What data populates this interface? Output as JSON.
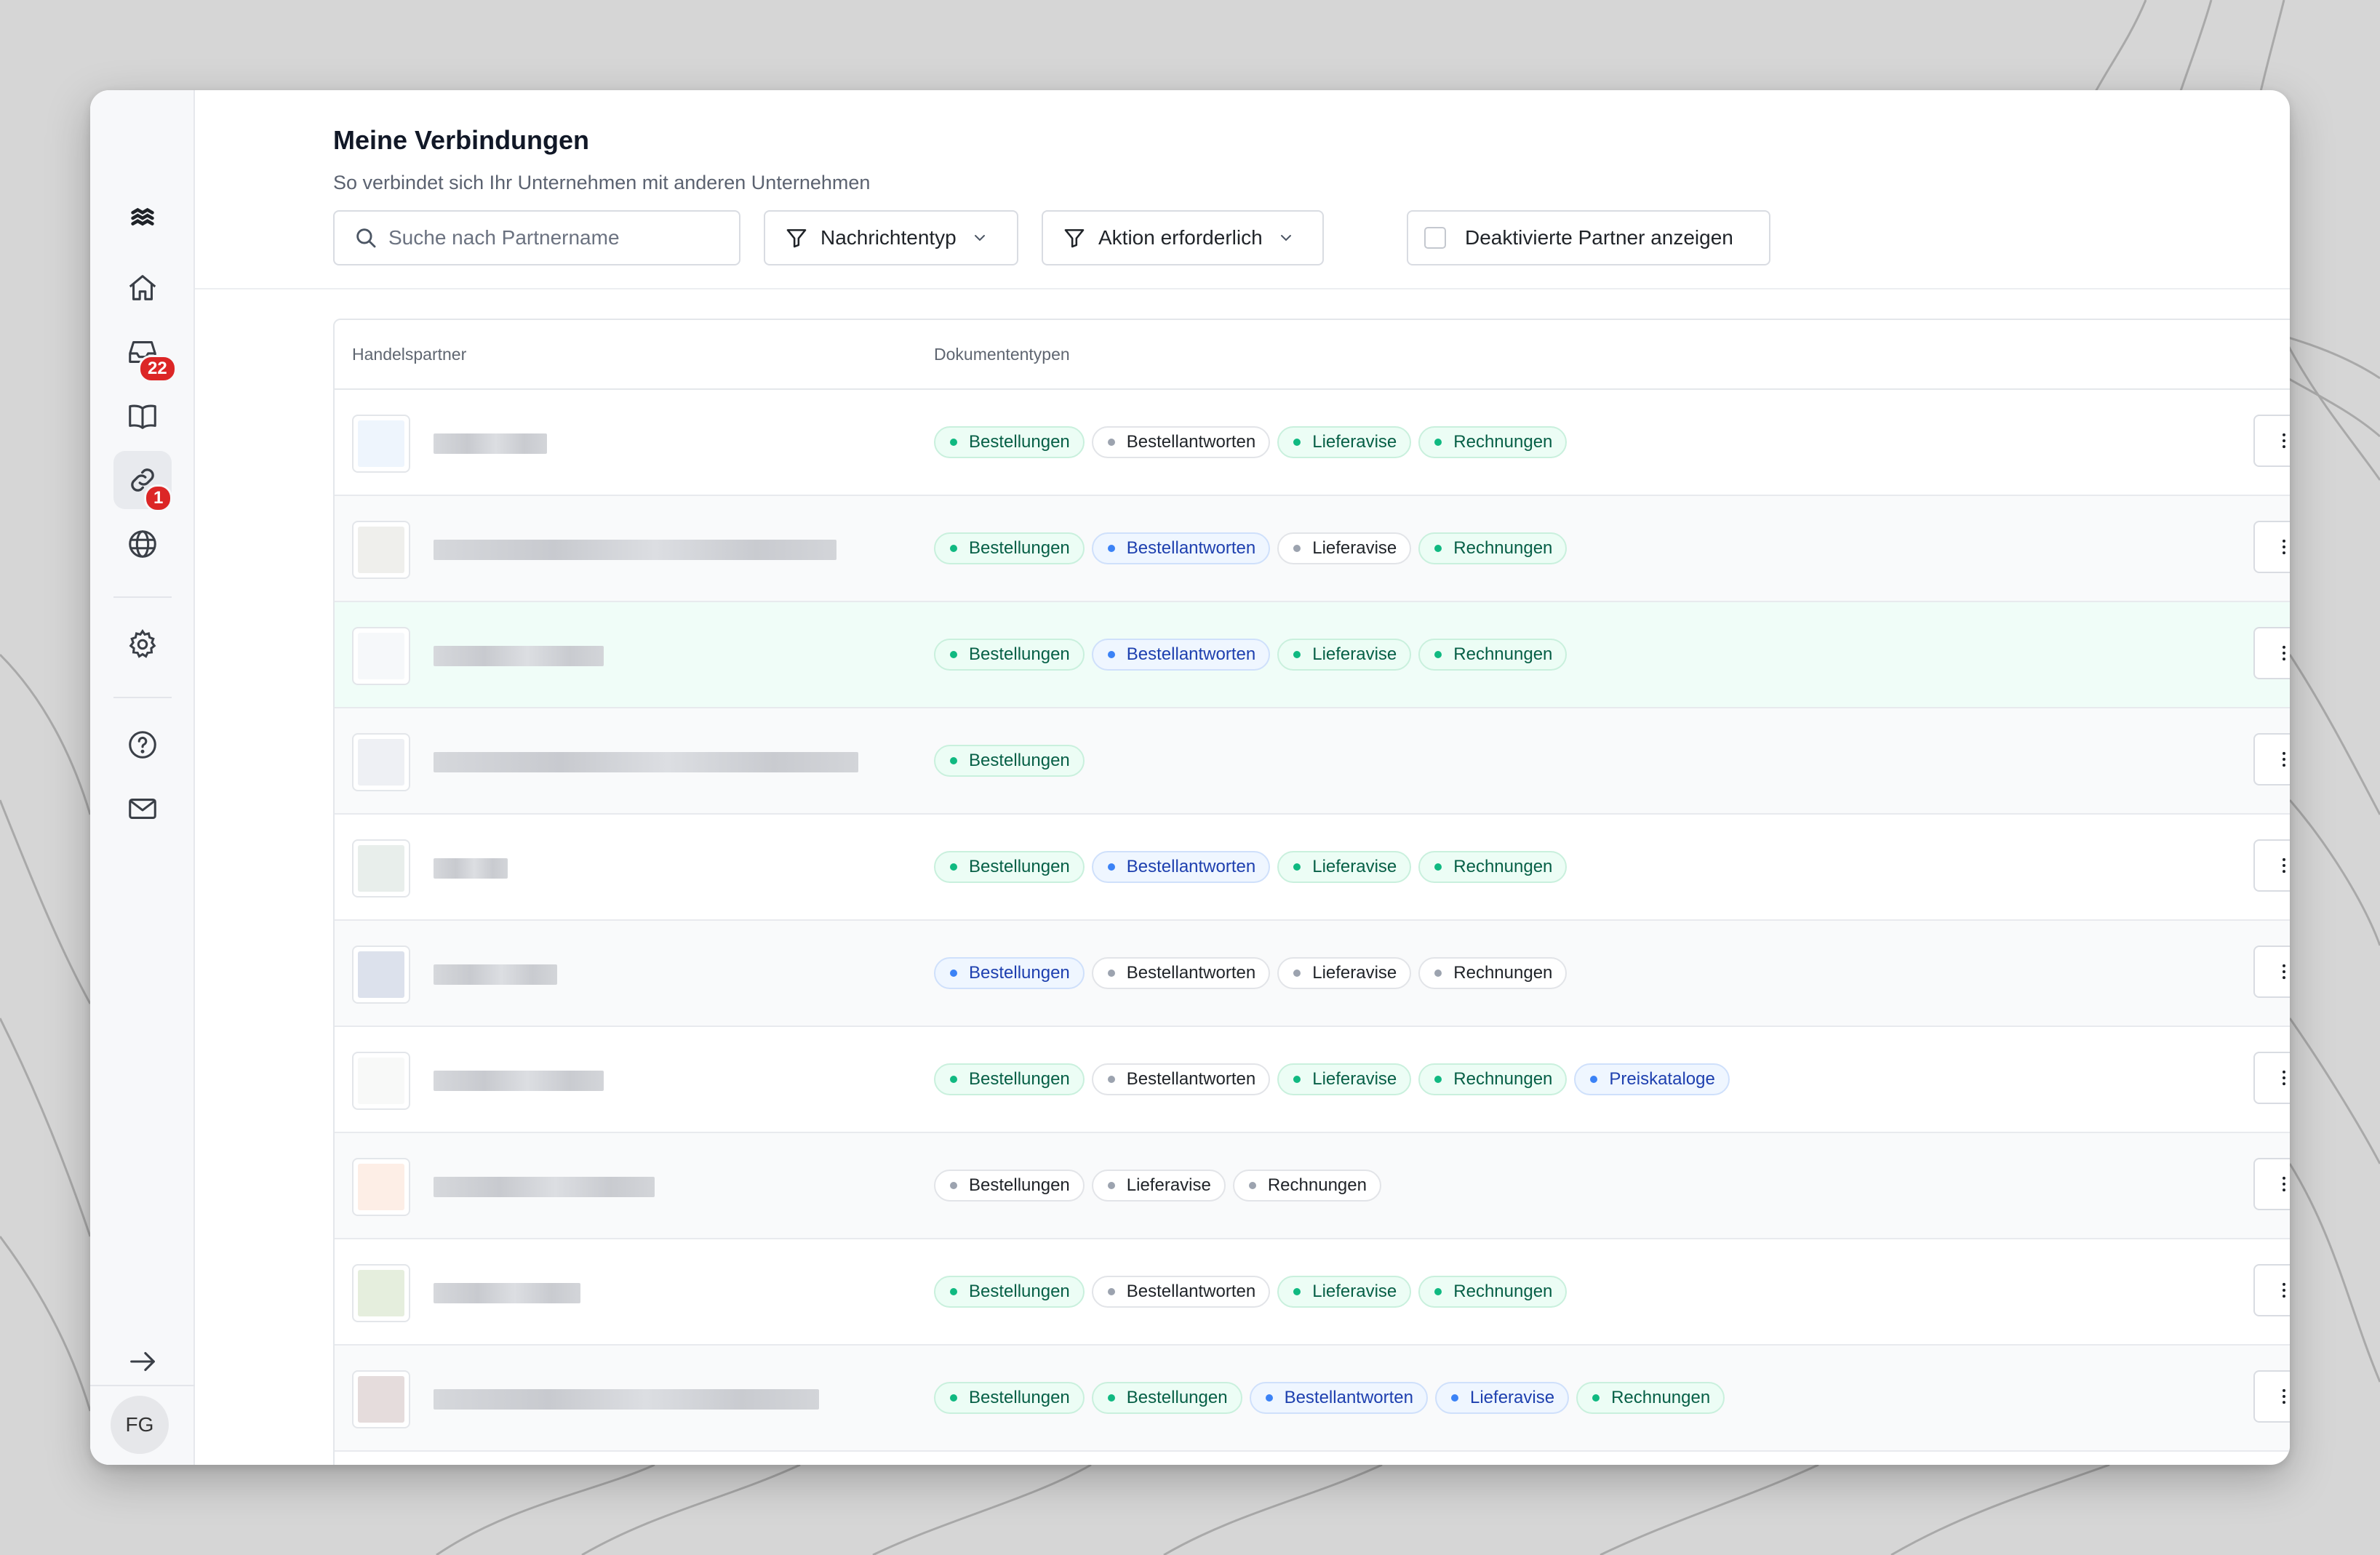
{
  "header": {
    "title": "Meine Verbindungen",
    "subtitle": "So verbindet sich Ihr Unternehmen mit anderen Unternehmen"
  },
  "search": {
    "placeholder": "Suche nach Partnername",
    "value": ""
  },
  "filters": {
    "message_type": "Nachrichtentyp",
    "action_required": "Aktion erforderlich",
    "show_deactivated": "Deaktivierte Partner anzeigen",
    "show_deactivated_checked": false
  },
  "sidebar": {
    "logo_icon": "wave-logo-icon",
    "items": [
      {
        "icon": "home-icon"
      },
      {
        "icon": "inbox-icon",
        "badge": "22"
      },
      {
        "icon": "book-icon"
      },
      {
        "icon": "link-icon",
        "badge": "1",
        "active": true
      },
      {
        "icon": "globe-icon"
      },
      {
        "icon": "gear-icon"
      },
      {
        "icon": "help-icon"
      },
      {
        "icon": "mail-icon"
      },
      {
        "icon": "arrow-right-icon"
      }
    ],
    "avatar": "FG"
  },
  "table": {
    "columns": [
      "Handelspartner",
      "Dokumententypen"
    ],
    "rows": [
      {
        "tags": [
          [
            "Bestellungen",
            "green"
          ],
          [
            "Bestellantworten",
            "gray"
          ],
          [
            "Lieferavise",
            "green"
          ],
          [
            "Rechnungen",
            "green"
          ]
        ]
      },
      {
        "tags": [
          [
            "Bestellungen",
            "green"
          ],
          [
            "Bestellantworten",
            "blue"
          ],
          [
            "Lieferavise",
            "gray"
          ],
          [
            "Rechnungen",
            "green"
          ]
        ]
      },
      {
        "tags": [
          [
            "Bestellungen",
            "green"
          ],
          [
            "Bestellantworten",
            "blue"
          ],
          [
            "Lieferavise",
            "green"
          ],
          [
            "Rechnungen",
            "green"
          ]
        ]
      },
      {
        "tags": [
          [
            "Bestellungen",
            "green"
          ]
        ]
      },
      {
        "tags": [
          [
            "Bestellungen",
            "green"
          ],
          [
            "Bestellantworten",
            "blue"
          ],
          [
            "Lieferavise",
            "green"
          ],
          [
            "Rechnungen",
            "green"
          ]
        ]
      },
      {
        "tags": [
          [
            "Bestellungen",
            "blue"
          ],
          [
            "Bestellantworten",
            "gray"
          ],
          [
            "Lieferavise",
            "gray"
          ],
          [
            "Rechnungen",
            "gray"
          ]
        ]
      },
      {
        "tags": [
          [
            "Bestellungen",
            "green"
          ],
          [
            "Bestellantworten",
            "gray"
          ],
          [
            "Lieferavise",
            "green"
          ],
          [
            "Rechnungen",
            "green"
          ],
          [
            "Preiskataloge",
            "blue"
          ]
        ]
      },
      {
        "tags": [
          [
            "Bestellungen",
            "gray"
          ],
          [
            "Lieferavise",
            "gray"
          ],
          [
            "Rechnungen",
            "gray"
          ]
        ]
      },
      {
        "tags": [
          [
            "Bestellungen",
            "green"
          ],
          [
            "Bestellantworten",
            "gray"
          ],
          [
            "Lieferavise",
            "green"
          ],
          [
            "Rechnungen",
            "green"
          ]
        ]
      },
      {
        "tags": [
          [
            "Bestellungen",
            "green"
          ],
          [
            "Bestellungen",
            "green"
          ],
          [
            "Bestellantworten",
            "blue"
          ],
          [
            "Lieferavise",
            "blue"
          ],
          [
            "Rechnungen",
            "green"
          ]
        ]
      }
    ]
  },
  "colors": {
    "status_green": "#10b981",
    "status_blue": "#3b82f6",
    "status_gray": "#9ca3af",
    "badge_red": "#dc2626",
    "highlight_row": "#f0fdf8"
  }
}
